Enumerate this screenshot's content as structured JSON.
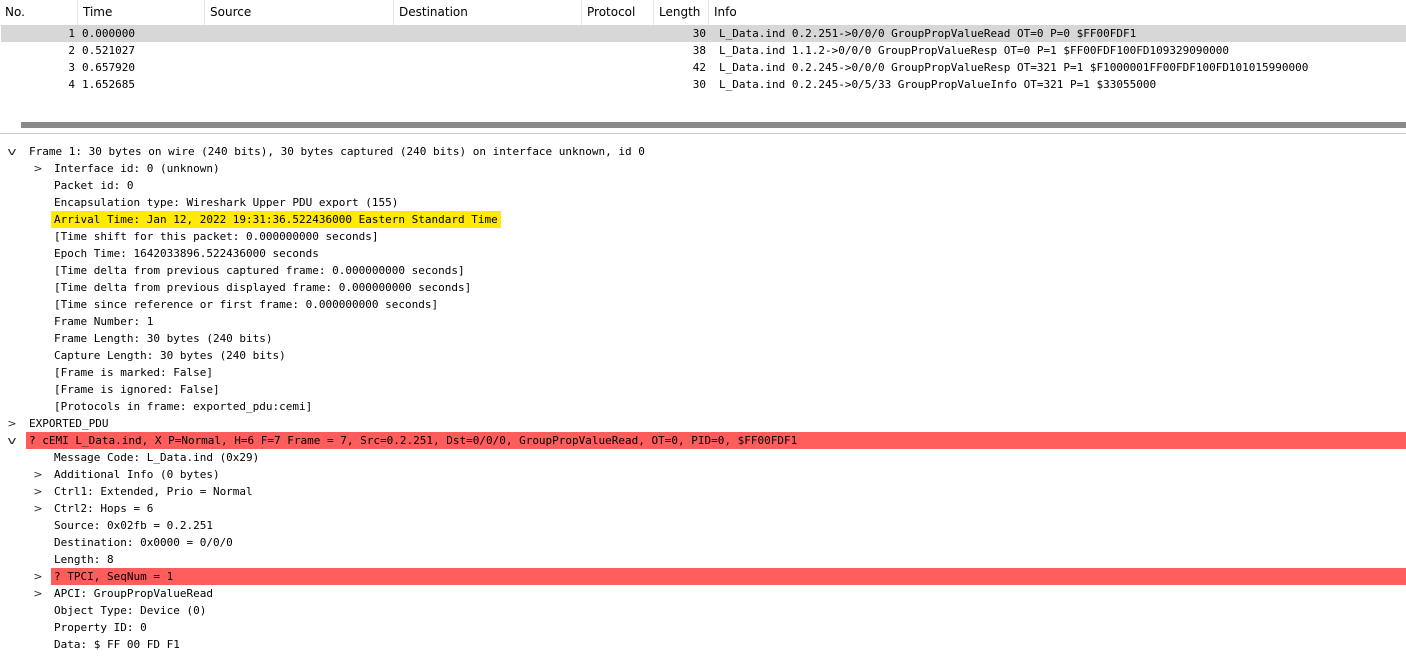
{
  "packet_list": {
    "columns": [
      "No.",
      "Time",
      "Source",
      "Destination",
      "Protocol",
      "Length",
      "Info"
    ],
    "rows": [
      {
        "no": "1",
        "time": "0.000000",
        "source": "",
        "destination": "",
        "protocol": "",
        "length": "30",
        "info": "L_Data.ind 0.2.251->0/0/0 GroupPropValueRead OT=0 P=0 $FF00FDF1"
      },
      {
        "no": "2",
        "time": "0.521027",
        "source": "",
        "destination": "",
        "protocol": "",
        "length": "38",
        "info": "L_Data.ind 1.1.2->0/0/0 GroupPropValueResp OT=0 P=1 $FF00FDF100FD109329090000"
      },
      {
        "no": "3",
        "time": "0.657920",
        "source": "",
        "destination": "",
        "protocol": "",
        "length": "42",
        "info": "L_Data.ind 0.2.245->0/0/0 GroupPropValueResp OT=321 P=1 $F1000001FF00FDF100FD101015990000"
      },
      {
        "no": "4",
        "time": "1.652685",
        "source": "",
        "destination": "",
        "protocol": "",
        "length": "30",
        "info": "L_Data.ind 0.2.245->0/5/33 GroupPropValueInfo OT=321 P=1 $33055000"
      }
    ]
  },
  "details": {
    "expand_collapsed": ">",
    "expand_open": "v",
    "lines": [
      {
        "level": 0,
        "expander": "open",
        "text": "Frame 1: 30 bytes on wire (240 bits), 30 bytes captured (240 bits) on interface unknown, id 0"
      },
      {
        "level": 1,
        "expander": "collapsed",
        "text": "Interface id: 0 (unknown)"
      },
      {
        "level": 1,
        "expander": "none",
        "text": "Packet id: 0"
      },
      {
        "level": 1,
        "expander": "none",
        "text": "Encapsulation type: Wireshark Upper PDU export (155)"
      },
      {
        "level": 1,
        "expander": "none",
        "text": "Arrival Time: Jan 12, 2022 19:31:36.522436000 Eastern Standard Time",
        "highlight": "yellow"
      },
      {
        "level": 1,
        "expander": "none",
        "text": "[Time shift for this packet: 0.000000000 seconds]"
      },
      {
        "level": 1,
        "expander": "none",
        "text": "Epoch Time: 1642033896.522436000 seconds"
      },
      {
        "level": 1,
        "expander": "none",
        "text": "[Time delta from previous captured frame: 0.000000000 seconds]"
      },
      {
        "level": 1,
        "expander": "none",
        "text": "[Time delta from previous displayed frame: 0.000000000 seconds]"
      },
      {
        "level": 1,
        "expander": "none",
        "text": "[Time since reference or first frame: 0.000000000 seconds]"
      },
      {
        "level": 1,
        "expander": "none",
        "text": "Frame Number: 1"
      },
      {
        "level": 1,
        "expander": "none",
        "text": "Frame Length: 30 bytes (240 bits)"
      },
      {
        "level": 1,
        "expander": "none",
        "text": "Capture Length: 30 bytes (240 bits)"
      },
      {
        "level": 1,
        "expander": "none",
        "text": "[Frame is marked: False]"
      },
      {
        "level": 1,
        "expander": "none",
        "text": "[Frame is ignored: False]"
      },
      {
        "level": 1,
        "expander": "none",
        "text": "[Protocols in frame: exported_pdu:cemi]"
      },
      {
        "level": 0,
        "expander": "collapsed",
        "text": "EXPORTED_PDU"
      },
      {
        "level": 0,
        "expander": "open",
        "text": "? cEMI L_Data.ind, X P=Normal, H=6 F=7 Frame = 7, Src=0.2.251, Dst=0/0/0, GroupPropValueRead, OT=0, PID=0, $FF00FDF1",
        "highlight": "red"
      },
      {
        "level": 1,
        "expander": "none",
        "text": "Message Code: L_Data.ind (0x29)"
      },
      {
        "level": 1,
        "expander": "collapsed",
        "text": "Additional Info (0 bytes)"
      },
      {
        "level": 1,
        "expander": "collapsed",
        "text": "Ctrl1: Extended, Prio = Normal"
      },
      {
        "level": 1,
        "expander": "collapsed",
        "text": "Ctrl2: Hops = 6"
      },
      {
        "level": 1,
        "expander": "none",
        "text": "Source: 0x02fb = 0.2.251"
      },
      {
        "level": 1,
        "expander": "none",
        "text": "Destination: 0x0000 = 0/0/0"
      },
      {
        "level": 1,
        "expander": "none",
        "text": "Length: 8"
      },
      {
        "level": 1,
        "expander": "collapsed",
        "text": "? TPCI, SeqNum = 1",
        "highlight": "red"
      },
      {
        "level": 1,
        "expander": "collapsed",
        "text": "APCI: GroupPropValueRead"
      },
      {
        "level": 1,
        "expander": "none",
        "text": "Object Type: Device (0)"
      },
      {
        "level": 1,
        "expander": "none",
        "text": "Property ID: 0"
      },
      {
        "level": 1,
        "expander": "none",
        "text": "Data: $ FF 00 FD F1"
      }
    ]
  },
  "colors": {
    "selected_row": "#d7d7d7",
    "highlight_yellow": "#ffea00",
    "highlight_red": "#ff5c5c"
  }
}
